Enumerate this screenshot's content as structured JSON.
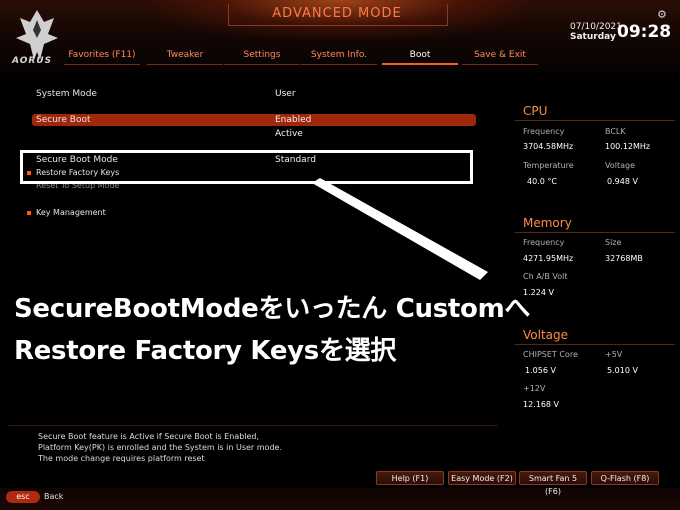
{
  "header": {
    "mode_title": "ADVANCED MODE",
    "logo_text": "AORUS",
    "date": "07/10/2021",
    "day": "Saturday",
    "time": "09:28",
    "gear_icon": "gear-icon"
  },
  "tabs": [
    {
      "label": "Favorites (F11)"
    },
    {
      "label": "Tweaker"
    },
    {
      "label": "Settings"
    },
    {
      "label": "System Info."
    },
    {
      "label": "Boot",
      "active": true
    },
    {
      "label": "Save & Exit"
    }
  ],
  "settings": {
    "system_mode_label": "System Mode",
    "system_mode_value": "User",
    "secure_boot_label": "Secure Boot",
    "secure_boot_value": "Enabled",
    "secure_boot_state": "Active",
    "secure_boot_mode_label": "Secure Boot Mode",
    "secure_boot_mode_value": "Standard",
    "restore_factory_keys": "Restore Factory Keys",
    "reset_to_setup_mode": "Reset To Setup Mode",
    "key_management": "Key Management"
  },
  "overlay": {
    "line1": "SecureBootModeをいったん Customへ",
    "line2": "Restore Factory Keysを選択"
  },
  "cpu": {
    "title": "CPU",
    "frequency_label": "Frequency",
    "frequency_value": "3704.58MHz",
    "bclk_label": "BCLK",
    "bclk_value": "100.12MHz",
    "temperature_label": "Temperature",
    "temperature_value": "40.0 °C",
    "voltage_label": "Voltage",
    "voltage_value": "0.948 V"
  },
  "memory": {
    "title": "Memory",
    "frequency_label": "Frequency",
    "frequency_value": "4271.95MHz",
    "size_label": "Size",
    "size_value": "32768MB",
    "chab_label": "Ch A/B Volt",
    "chab_value": "1.224 V"
  },
  "voltage": {
    "title": "Voltage",
    "chipset_label": "CHIPSET Core",
    "chipset_value": "1.056 V",
    "p5v_label": "+5V",
    "p5v_value": "5.010 V",
    "p12v_label": "+12V",
    "p12v_value": "12.168 V"
  },
  "help": {
    "line1": "Secure Boot feature is Active if Secure Boot is Enabled,",
    "line2": "Platform Key(PK) is enrolled and the System is in User mode.",
    "line3": "The mode change requires platform reset"
  },
  "buttons": {
    "help": "Help (F1)",
    "easy_mode": "Easy Mode (F2)",
    "smart_fan": "Smart Fan 5 (F6)",
    "qflash": "Q-Flash (F8)"
  },
  "footer": {
    "esc": "esc",
    "back": "Back"
  },
  "colors": {
    "accent": "#ff5a1a",
    "selection": "#a0260c",
    "section_title": "#ff8a4a"
  }
}
